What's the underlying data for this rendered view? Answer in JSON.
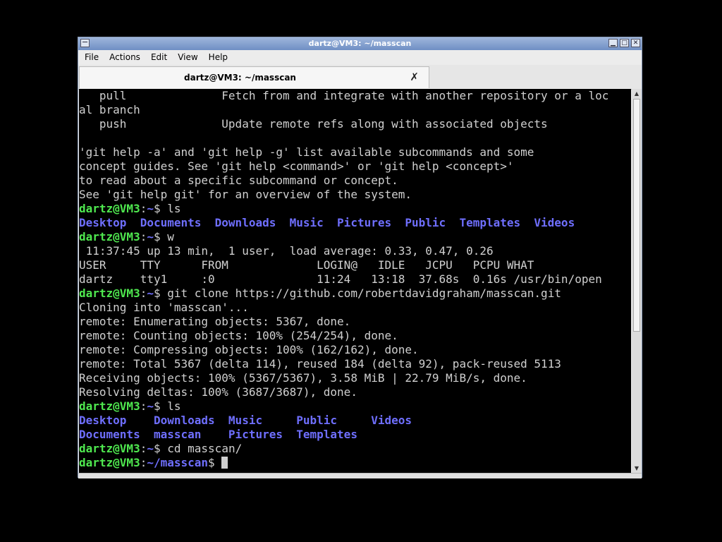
{
  "window": {
    "title": "dartz@VM3: ~/masscan"
  },
  "menu": [
    "File",
    "Actions",
    "Edit",
    "View",
    "Help"
  ],
  "tab": {
    "label": "dartz@VM3: ~/masscan",
    "close_glyph": "✗"
  },
  "terminal": {
    "prompt_user": "dartz@VM3",
    "lines": [
      {
        "text": "   pull              Fetch from and integrate with another repository or a loc"
      },
      {
        "text": "al branch"
      },
      {
        "text": "   push              Update remote refs along with associated objects"
      },
      {
        "text": ""
      },
      {
        "text": "'git help -a' and 'git help -g' list available subcommands and some"
      },
      {
        "text": "concept guides. See 'git help <command>' or 'git help <concept>'"
      },
      {
        "text": "to read about a specific subcommand or concept."
      },
      {
        "text": "See 'git help git' for an overview of the system."
      },
      {
        "cwd": "~",
        "cmd": "ls"
      },
      {
        "dirs": "Desktop  Documents  Downloads  Music  Pictures  Public  Templates  Videos"
      },
      {
        "cwd": "~",
        "cmd": "w"
      },
      {
        "text": " 11:37:45 up 13 min,  1 user,  load average: 0.33, 0.47, 0.26"
      },
      {
        "text": "USER     TTY      FROM             LOGIN@   IDLE   JCPU   PCPU WHAT"
      },
      {
        "text": "dartz    tty1     :0               11:24   13:18  37.68s  0.16s /usr/bin/open"
      },
      {
        "cwd": "~",
        "cmd": "git clone https://github.com/robertdavidgraham/masscan.git"
      },
      {
        "text": "Cloning into 'masscan'..."
      },
      {
        "text": "remote: Enumerating objects: 5367, done."
      },
      {
        "text": "remote: Counting objects: 100% (254/254), done."
      },
      {
        "text": "remote: Compressing objects: 100% (162/162), done."
      },
      {
        "text": "remote: Total 5367 (delta 114), reused 184 (delta 92), pack-reused 5113"
      },
      {
        "text": "Receiving objects: 100% (5367/5367), 3.58 MiB | 22.79 MiB/s, done."
      },
      {
        "text": "Resolving deltas: 100% (3687/3687), done."
      },
      {
        "cwd": "~",
        "cmd": "ls"
      },
      {
        "dirs": "Desktop    Downloads  Music     Public     Videos"
      },
      {
        "dirs": "Documents  masscan    Pictures  Templates"
      },
      {
        "cwd": "~",
        "cmd": "cd masscan/"
      },
      {
        "cwd": "~/masscan",
        "cmd": "",
        "cursor": true
      }
    ]
  },
  "colors": {
    "prompt": "#4fe84f",
    "directory": "#6f6fff",
    "text": "#d0d0d0",
    "background": "#000000"
  }
}
